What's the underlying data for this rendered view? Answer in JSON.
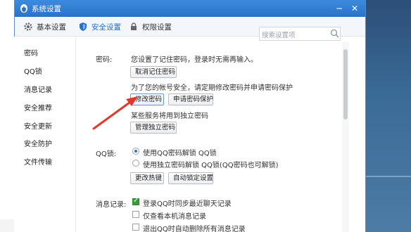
{
  "window": {
    "title": "系统设置",
    "min_glyph": "−",
    "close_glyph": "✕"
  },
  "tabs": [
    {
      "label": "基本设置",
      "icon": "gear-icon"
    },
    {
      "label": "安全设置",
      "icon": "shield-icon",
      "active": true
    },
    {
      "label": "权限设置",
      "icon": "lock-icon"
    }
  ],
  "search": {
    "placeholder": "搜索设置项"
  },
  "sidebar": {
    "items": [
      {
        "label": "密码"
      },
      {
        "label": "QQ锁"
      },
      {
        "label": "消息记录"
      },
      {
        "label": "安全推荐"
      },
      {
        "label": "安全更新"
      },
      {
        "label": "安全防护"
      },
      {
        "label": "文件传输"
      }
    ]
  },
  "password": {
    "section_label": "密码:",
    "remembered_text": "您设置了记住密码，登录时无需再输入。",
    "cancel_remember_button": "取消记住密码",
    "advice_text": "为了您的帐号安全，请定期修改密码并申请密码保护",
    "change_password_button": "修改密码",
    "apply_protection_button": "申请密码保护",
    "independent_text": "某些服务将用到独立密码",
    "manage_independent_button": "管理独立密码"
  },
  "qq_lock": {
    "section_label": "QQ锁:",
    "option_qq_password": "使用QQ密码解锁 QQ锁",
    "option_independent": "使用独立密码解锁 QQ锁(QQ密码也可解锁)",
    "hotkey_button": "更改热键",
    "auto_lock_button": "自动锁定设置"
  },
  "message_log": {
    "section_label": "消息记录:",
    "option_sync": "登录QQ时同步最近聊天记录",
    "option_local_only": "仅查看本机消息记录",
    "option_delete_on_exit": "退出QQ时自动删除所有消息记录"
  },
  "colors": {
    "titlebar": "#2a72c8",
    "active_tab": "#1a6fc9",
    "arrow": "#e0392b",
    "checked": "#3a9a3a"
  }
}
